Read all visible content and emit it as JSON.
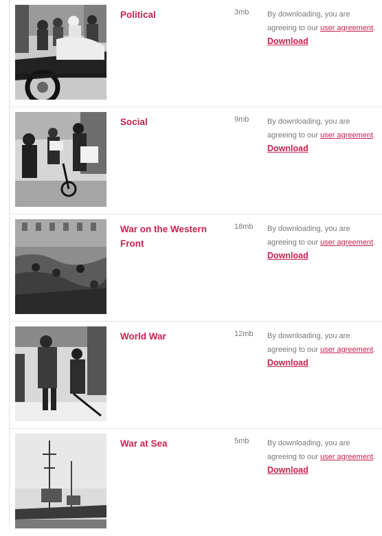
{
  "colors": {
    "accent": "#c8224f",
    "muted_text": "#777777",
    "divider": "#e6e6e6"
  },
  "downloads": [
    {
      "title": "Political",
      "size": "3mb",
      "notice_text": "By downloading, you are agreeing to our ",
      "agreement_link": "user agreement",
      "notice_end": ".",
      "download_label": "Download"
    },
    {
      "title": "Social",
      "size": "9mb",
      "notice_text": "By downloading, you are agreeing to our ",
      "agreement_link": "user agreement",
      "notice_end": ".",
      "download_label": "Download"
    },
    {
      "title": "War on the Western Front",
      "size": "18mb",
      "notice_text": "By downloading, you are agreeing to our ",
      "agreement_link": "user agreement",
      "notice_end": ".",
      "download_label": "Download"
    },
    {
      "title": "World War",
      "size": "12mb",
      "notice_text": "By downloading, you are agreeing to our ",
      "agreement_link": "user agreement",
      "notice_end": ".",
      "download_label": "Download"
    },
    {
      "title": "War at Sea",
      "size": "5mb",
      "notice_text": "By downloading, you are agreeing to our ",
      "agreement_link": "user agreement",
      "notice_end": ".",
      "download_label": "Download"
    }
  ]
}
